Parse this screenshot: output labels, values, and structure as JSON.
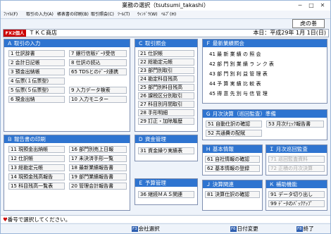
{
  "window": {
    "title": "業務の選択（tsutsumi_takashi）",
    "minimize": "─",
    "maximize": "□",
    "close": "✕"
  },
  "menu": [
    "ﾌｧｲﾙ(F)",
    "取引の入力(A)",
    "帳表書の印刷(B)",
    "取引照会(C)",
    "ﾂｰﾙ(T)",
    "ｳｨﾝﾄﾞｳ(W)",
    "ﾍﾙﾌﾟ(H)"
  ],
  "tora": "虎の巻",
  "company": {
    "badge": "FX2個人",
    "name": "ＴＫＣ商店",
    "date": "本日：平成29年 1月 1日(日)"
  },
  "panels": {
    "A": {
      "title": "Ａ 取引の入力",
      "left": [
        "1 仕訳辞書",
        "2 会計日記帳",
        "3 預金出納帳",
        "4 伝票(１伝票型)",
        "5 伝票(５伝票型)",
        "6 現金出納"
      ],
      "right": [
        "7 銀行信販ﾃﾞｰﾀ受信",
        "8 仕訳の読込",
        "65 TDSとのﾃﾞｰﾀ連携",
        "9 入力データ検索",
        "10 入力モニター"
      ]
    },
    "B": {
      "title": "Ｂ 報告書の印刷",
      "left": [
        "11 現預金出納帳",
        "12 仕訳帳",
        "13 総勘定元帳",
        "14 現預金残高報告",
        "15 科目残高一覧表"
      ],
      "right": [
        "16 部門別売上日報",
        "17 未決済手形一覧",
        "18 最新業績報告書",
        "19 部門業績報告書",
        "20 管理会計報告書"
      ]
    },
    "C": {
      "title": "Ｃ 取引照会",
      "items": [
        "21 仕訳帳",
        "22 総勘定元帳",
        "23 部門別取引",
        "24 勘定科目残高",
        "25 部門別科目残高",
        "26 課税区分別取引",
        "27 科目別月間取引",
        "28 手形明細",
        "29 訂正・加除履歴"
      ]
    },
    "D": {
      "title": "Ｄ 資金管理",
      "items": [
        "31 資金繰り実績表"
      ]
    },
    "E": {
      "title": "Ｅ 予算管理",
      "items": [
        "36 継続ＭＡＳ関連"
      ]
    },
    "F": {
      "title": "Ｆ 最新業績照会",
      "items": [
        "41 最 新 業 績 の 照 会",
        "42 部 門 別 業 績 ラ ン ク 表",
        "43 部 門 別 利 益 管 理 表",
        "44 予 算 実 績 比 較 表",
        "45 得 意 先 別 与 信 管 理"
      ]
    },
    "G": {
      "title": "Ｇ 月次決算（巡回監査）準備",
      "left": [
        "51 自動仕訳の確認",
        "52 共通費の配賦"
      ],
      "right": [
        "53 月次ﾁｪｯｸ報告書"
      ]
    },
    "H": {
      "title": "Ｈ 基本情報",
      "items": [
        "61 自社情報の確認",
        "62 基本情報の登録"
      ]
    },
    "I": {
      "title": "Ｉ 月次巡回監査",
      "items": [
        "71 巡回監査資料",
        "72 正積の月次決算"
      ]
    },
    "J": {
      "title": "Ｊ 決算関連",
      "items": [
        "81 決算仕訳の確認"
      ]
    },
    "K": {
      "title": "Ｋ 補助機能",
      "items": [
        "91 データ切り出し",
        "99 ﾃﾞｰﾀのﾊﾞｯｸｱｯﾌﾟ"
      ]
    }
  },
  "status": {
    "icon": "♥",
    "text": "番号で選択してください。"
  },
  "fkeys": [
    {
      "key": "F3",
      "label": "会社選択"
    },
    {
      "key": "F6",
      "label": "日付変更"
    },
    {
      "key": "F8",
      "label": "終了"
    }
  ]
}
